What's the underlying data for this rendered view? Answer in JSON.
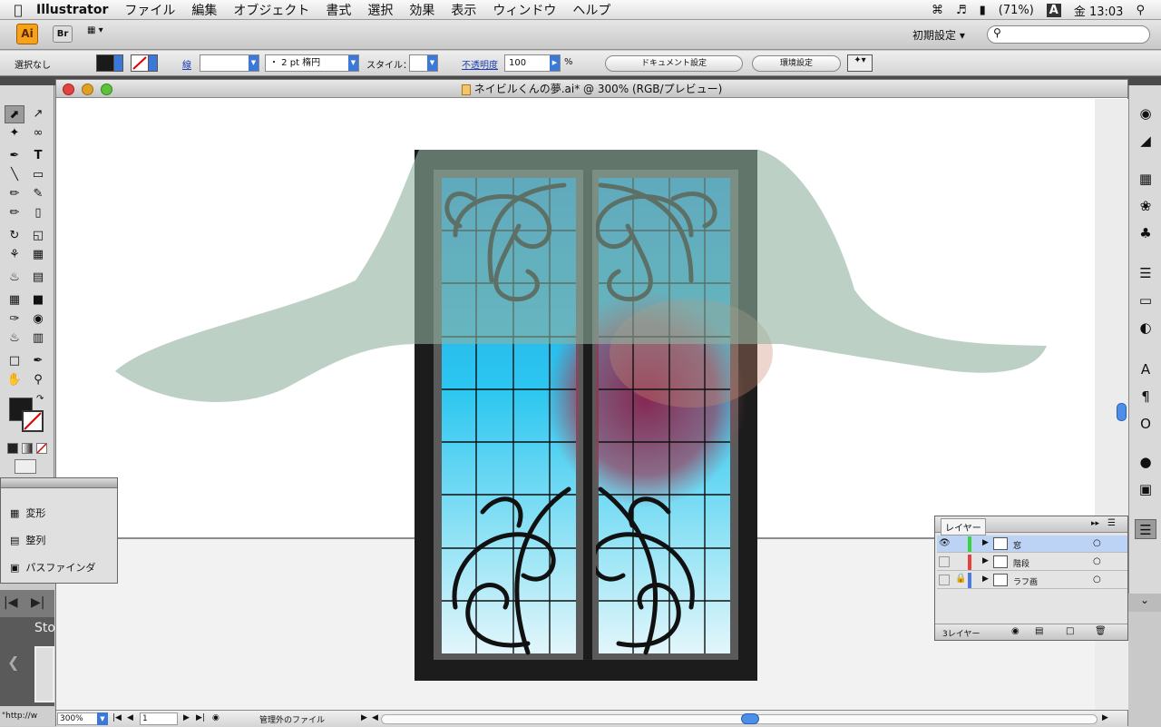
{
  "menubar": {
    "app": "Illustrator",
    "items": [
      "ファイル",
      "編集",
      "オブジェクト",
      "書式",
      "選択",
      "効果",
      "表示",
      "ウィンドウ",
      "ヘルプ"
    ],
    "battery": "(71%)",
    "input_method": "A",
    "clock": "金 13:03"
  },
  "appbar": {
    "ai_label": "Ai",
    "br_label": "Br",
    "workspace": "初期設定"
  },
  "control": {
    "selection": "選択なし",
    "stroke_label": "線",
    "brush": "・ 2 pt 楕円",
    "style_label": "スタイル：",
    "opacity_label": "不透明度",
    "opacity_value": "100",
    "percent": "%",
    "doc_setup": "ドキュメント設定",
    "prefs": "環境設定"
  },
  "document": {
    "title": "ネイビルくんの夢.ai* @ 300% (RGB/プレビュー)"
  },
  "statusbar": {
    "url": "\"http://w",
    "zoom": "300%",
    "page": "1",
    "file_status": "管理外のファイル"
  },
  "floatpanel": {
    "items": [
      "変形",
      "整列",
      "パスファインダ"
    ]
  },
  "filmstrip": {
    "label": "Sto"
  },
  "layers": {
    "tab": "レイヤー",
    "rows": [
      {
        "name": "窓",
        "color": "#3bd33b"
      },
      {
        "name": "階段",
        "color": "#e84040"
      },
      {
        "name": "ラフ画",
        "color": "#4a78e8"
      }
    ],
    "count": "3レイヤー"
  },
  "colors": {
    "window_frame": "#1c1c1c",
    "curtain": "#b9cfc4",
    "sky": "#1fb4ee"
  }
}
